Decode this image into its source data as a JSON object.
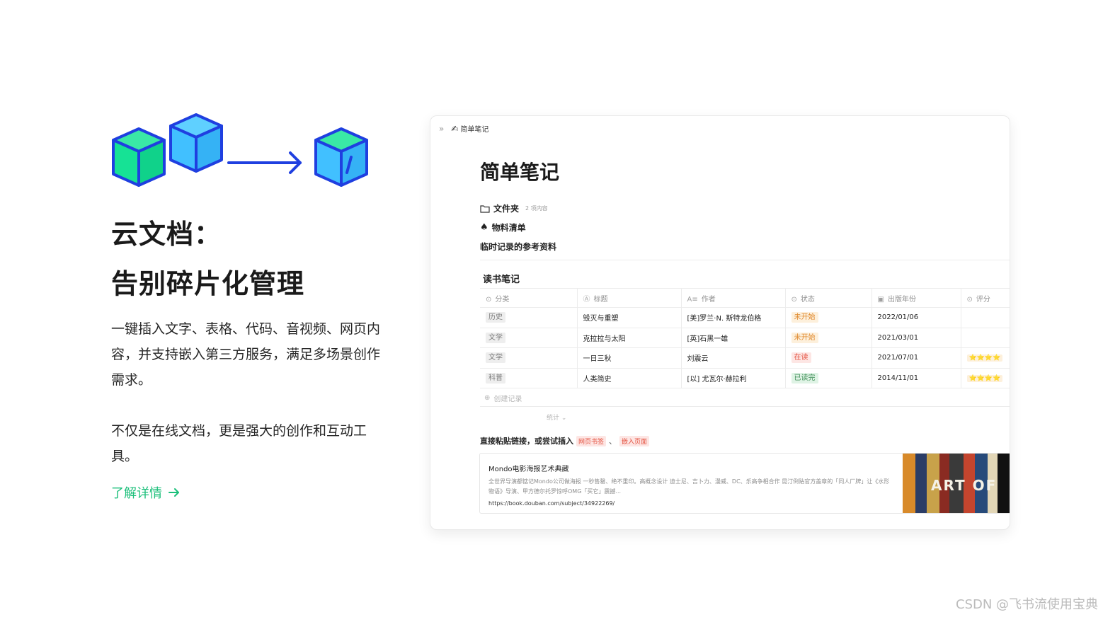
{
  "hero": {
    "headline_line1": "云文档：",
    "headline_line2": "告别碎片化管理",
    "desc1": "一键插入文字、表格、代码、音视频、网页内容，并支持嵌入第三方服务，满足多场景创作需求。",
    "desc2": "不仅是在线文档，更是强大的创作和互动工具。",
    "learn_more": "了解详情",
    "colors": {
      "accent_green": "#1bbf7a",
      "cube_green": "#16e295",
      "cube_blue": "#41c0ff",
      "outline_blue": "#1f3fe0"
    }
  },
  "doc": {
    "breadcrumb_icon": "chevrons-right-icon",
    "page_emoji": "✍",
    "breadcrumb": "简单笔记",
    "title": "简单笔记",
    "folder_label": "文件夹",
    "folder_count": "2 项内容",
    "list_label": "物料清单",
    "ref_label": "临时记录的参考资料",
    "db_title": "读书笔记",
    "columns": [
      "分类",
      "标题",
      "作者",
      "状态",
      "出版年份",
      "评分"
    ],
    "rows": [
      {
        "category": "历史",
        "title": "毁灭与重塑",
        "author": "[美]罗兰·N. 斯特龙伯格",
        "status": "未开始",
        "year": "2022/01/06",
        "rating": ""
      },
      {
        "category": "文学",
        "title": "克拉拉与太阳",
        "author": "[英]石黑一雄",
        "status": "未开始",
        "year": "2021/03/01",
        "rating": ""
      },
      {
        "category": "文学",
        "title": "一日三秋",
        "author": "刘震云",
        "status": "在读",
        "year": "2021/07/01",
        "rating": "⭐⭐⭐⭐"
      },
      {
        "category": "科普",
        "title": "人类简史",
        "author": "[以] 尤瓦尔·赫拉利",
        "status": "已读完",
        "year": "2014/11/01",
        "rating": "⭐⭐⭐⭐"
      }
    ],
    "new_record": "创建记录",
    "stats": "统计 ⌄",
    "paste_prefix": "直接粘贴链接，或尝试插入",
    "paste_pill1": "网页书签",
    "paste_sep": "、",
    "paste_pill2": "嵌入页面",
    "bookmark": {
      "title": "Mondo电影海报艺术典藏",
      "desc": "全世界导演都惦记Mondo公司做海报 一秒售罄、绝不重印。高概念设计 迪士尼、吉卜力、漫威、DC、乐高争相合作 昆汀倒贴官方盖章的「同人厂牌」让《水形物语》导演、甲方德尔托罗惊呼OMG「买它」震撼...",
      "url": "https://book.douban.com/subject/34922269/",
      "thumb_text": "ART OF"
    }
  },
  "watermark": "CSDN @飞书流使用宝典"
}
